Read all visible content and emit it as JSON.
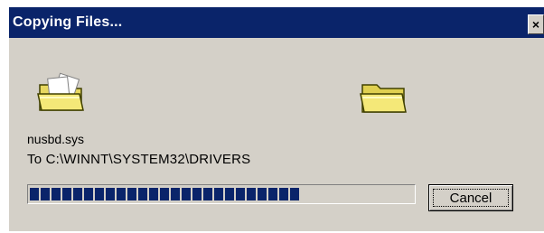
{
  "window": {
    "title": "Copying Files...",
    "close_glyph": "×"
  },
  "icons": {
    "source": "folder-with-papers-icon",
    "destination": "folder-icon",
    "folder_color": "#f0e060"
  },
  "copy": {
    "filename": "nusbd.sys",
    "destination": "To C:\\WINNT\\SYSTEM32\\DRIVERS",
    "progress_percent": 72
  },
  "buttons": {
    "cancel_label": "Cancel"
  },
  "colors": {
    "titlebar": "#0a246a",
    "face": "#d4d0c8",
    "progress": "#0a246a"
  }
}
